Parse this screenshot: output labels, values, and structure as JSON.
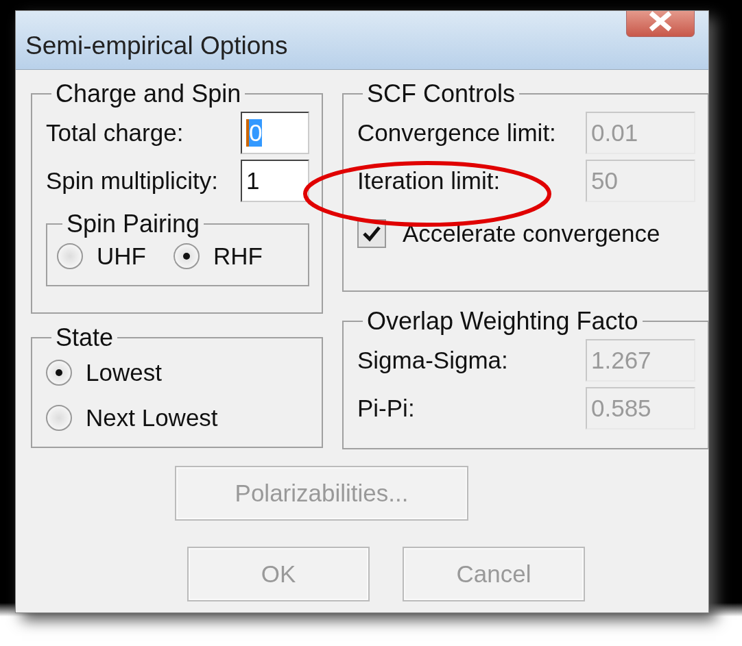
{
  "window": {
    "title": "Semi-empirical Options"
  },
  "charge_and_spin": {
    "title": "Charge and Spin",
    "fields": [
      {
        "label": "Total charge:",
        "value": "0",
        "selected": true
      },
      {
        "label": "Spin multiplicity:",
        "value": "1",
        "selected": false
      }
    ],
    "spin_pairing": {
      "title": "Spin Pairing",
      "options": [
        {
          "label": "UHF",
          "selected": false
        },
        {
          "label": "RHF",
          "selected": true
        }
      ]
    }
  },
  "state": {
    "title": "State",
    "options": [
      {
        "label": "Lowest",
        "selected": true
      },
      {
        "label": "Next Lowest",
        "selected": false
      }
    ]
  },
  "scf_controls": {
    "title": "SCF Controls",
    "fields": [
      {
        "label": "Convergence limit:",
        "value": "0.01",
        "disabled": true
      },
      {
        "label": "Iteration limit:",
        "value": "50",
        "disabled": true
      }
    ],
    "accelerate": {
      "label": "Accelerate convergence",
      "checked": true
    }
  },
  "overlap_weighting": {
    "title": "Overlap Weighting Facto",
    "fields": [
      {
        "label": "Sigma-Sigma:",
        "value": "1.267",
        "disabled": true
      },
      {
        "label": "Pi-Pi:",
        "value": "0.585",
        "disabled": true
      }
    ]
  },
  "polarizabilities_button": {
    "label": "Polarizabilities...",
    "disabled": true
  },
  "buttons": [
    {
      "label": "OK",
      "disabled": true
    },
    {
      "label": "Cancel",
      "disabled": true
    }
  ]
}
